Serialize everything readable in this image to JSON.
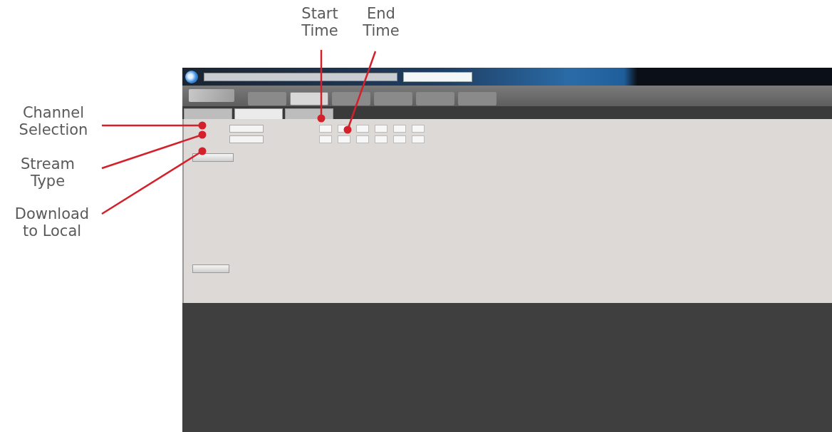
{
  "callouts": [
    {
      "label": "Channel\nSelection"
    },
    {
      "label": "Stream\nType"
    },
    {
      "label": "Download\nto Local"
    },
    {
      "label": "Start\nTime"
    },
    {
      "label": "End\nTime"
    }
  ],
  "screen": {
    "nav_buttons": [
      {
        "selected": false
      },
      {
        "selected": true
      },
      {
        "selected": false
      },
      {
        "selected": false
      },
      {
        "selected": false
      },
      {
        "selected": false
      }
    ],
    "tabs": [
      {
        "selected": false
      },
      {
        "selected": true
      },
      {
        "selected": false
      }
    ]
  }
}
